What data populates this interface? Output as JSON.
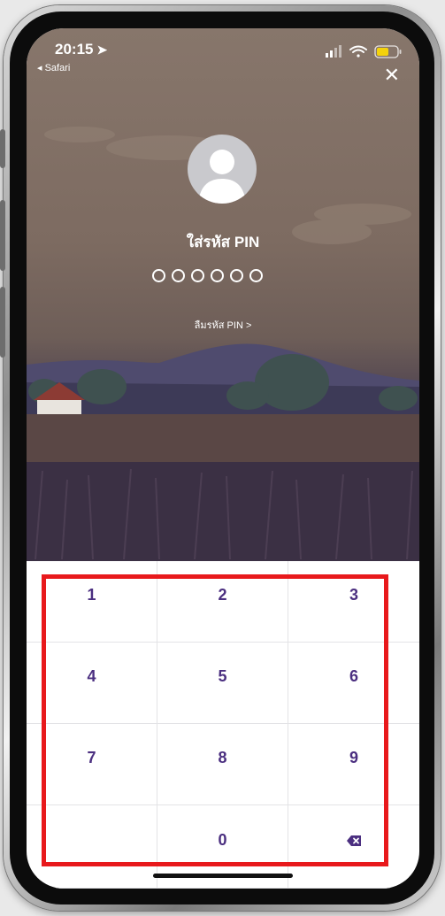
{
  "status_bar": {
    "time": "20:15",
    "back_app": "◂ Safari",
    "battery_color": "#f4d20c"
  },
  "header": {
    "close_glyph": "✕"
  },
  "pin": {
    "title": "ใส่รหัส PIN",
    "length": 6,
    "forgot_label": "ลืมรหัส PIN >"
  },
  "keypad": {
    "keys": [
      "1",
      "2",
      "3",
      "4",
      "5",
      "6",
      "7",
      "8",
      "9",
      "",
      "0",
      "⌫"
    ],
    "text_color": "#4b2f80",
    "highlight_color": "#e8191c"
  },
  "icons": {
    "location": "location-arrow-icon",
    "signal": "signal-icon",
    "wifi": "wifi-icon",
    "battery": "battery-icon",
    "close": "close-icon",
    "avatar": "user-avatar-icon",
    "backspace": "backspace-icon"
  }
}
